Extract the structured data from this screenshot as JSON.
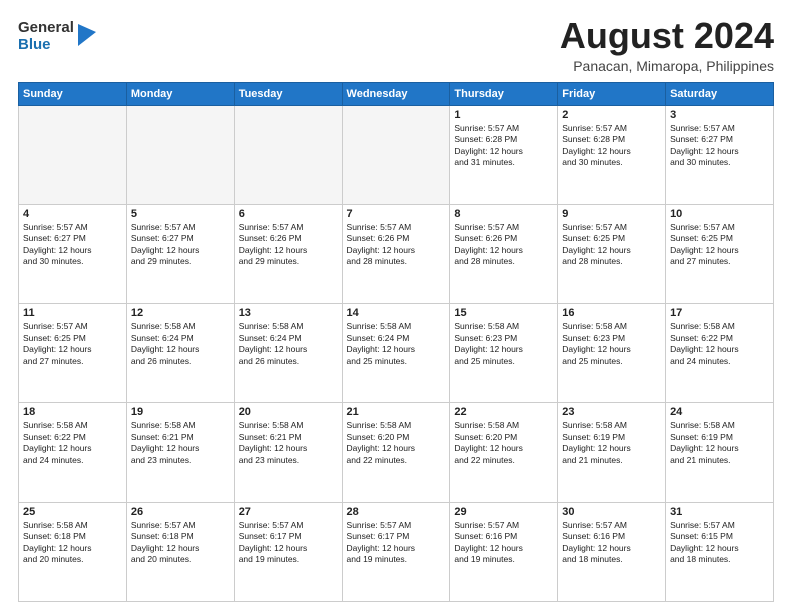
{
  "logo": {
    "general": "General",
    "blue": "Blue"
  },
  "title": "August 2024",
  "location": "Panacan, Mimaropa, Philippines",
  "weekdays": [
    "Sunday",
    "Monday",
    "Tuesday",
    "Wednesday",
    "Thursday",
    "Friday",
    "Saturday"
  ],
  "weeks": [
    [
      {
        "day": "",
        "info": ""
      },
      {
        "day": "",
        "info": ""
      },
      {
        "day": "",
        "info": ""
      },
      {
        "day": "",
        "info": ""
      },
      {
        "day": "1",
        "info": "Sunrise: 5:57 AM\nSunset: 6:28 PM\nDaylight: 12 hours\nand 31 minutes."
      },
      {
        "day": "2",
        "info": "Sunrise: 5:57 AM\nSunset: 6:28 PM\nDaylight: 12 hours\nand 30 minutes."
      },
      {
        "day": "3",
        "info": "Sunrise: 5:57 AM\nSunset: 6:27 PM\nDaylight: 12 hours\nand 30 minutes."
      }
    ],
    [
      {
        "day": "4",
        "info": "Sunrise: 5:57 AM\nSunset: 6:27 PM\nDaylight: 12 hours\nand 30 minutes."
      },
      {
        "day": "5",
        "info": "Sunrise: 5:57 AM\nSunset: 6:27 PM\nDaylight: 12 hours\nand 29 minutes."
      },
      {
        "day": "6",
        "info": "Sunrise: 5:57 AM\nSunset: 6:26 PM\nDaylight: 12 hours\nand 29 minutes."
      },
      {
        "day": "7",
        "info": "Sunrise: 5:57 AM\nSunset: 6:26 PM\nDaylight: 12 hours\nand 28 minutes."
      },
      {
        "day": "8",
        "info": "Sunrise: 5:57 AM\nSunset: 6:26 PM\nDaylight: 12 hours\nand 28 minutes."
      },
      {
        "day": "9",
        "info": "Sunrise: 5:57 AM\nSunset: 6:25 PM\nDaylight: 12 hours\nand 28 minutes."
      },
      {
        "day": "10",
        "info": "Sunrise: 5:57 AM\nSunset: 6:25 PM\nDaylight: 12 hours\nand 27 minutes."
      }
    ],
    [
      {
        "day": "11",
        "info": "Sunrise: 5:57 AM\nSunset: 6:25 PM\nDaylight: 12 hours\nand 27 minutes."
      },
      {
        "day": "12",
        "info": "Sunrise: 5:58 AM\nSunset: 6:24 PM\nDaylight: 12 hours\nand 26 minutes."
      },
      {
        "day": "13",
        "info": "Sunrise: 5:58 AM\nSunset: 6:24 PM\nDaylight: 12 hours\nand 26 minutes."
      },
      {
        "day": "14",
        "info": "Sunrise: 5:58 AM\nSunset: 6:24 PM\nDaylight: 12 hours\nand 25 minutes."
      },
      {
        "day": "15",
        "info": "Sunrise: 5:58 AM\nSunset: 6:23 PM\nDaylight: 12 hours\nand 25 minutes."
      },
      {
        "day": "16",
        "info": "Sunrise: 5:58 AM\nSunset: 6:23 PM\nDaylight: 12 hours\nand 25 minutes."
      },
      {
        "day": "17",
        "info": "Sunrise: 5:58 AM\nSunset: 6:22 PM\nDaylight: 12 hours\nand 24 minutes."
      }
    ],
    [
      {
        "day": "18",
        "info": "Sunrise: 5:58 AM\nSunset: 6:22 PM\nDaylight: 12 hours\nand 24 minutes."
      },
      {
        "day": "19",
        "info": "Sunrise: 5:58 AM\nSunset: 6:21 PM\nDaylight: 12 hours\nand 23 minutes."
      },
      {
        "day": "20",
        "info": "Sunrise: 5:58 AM\nSunset: 6:21 PM\nDaylight: 12 hours\nand 23 minutes."
      },
      {
        "day": "21",
        "info": "Sunrise: 5:58 AM\nSunset: 6:20 PM\nDaylight: 12 hours\nand 22 minutes."
      },
      {
        "day": "22",
        "info": "Sunrise: 5:58 AM\nSunset: 6:20 PM\nDaylight: 12 hours\nand 22 minutes."
      },
      {
        "day": "23",
        "info": "Sunrise: 5:58 AM\nSunset: 6:19 PM\nDaylight: 12 hours\nand 21 minutes."
      },
      {
        "day": "24",
        "info": "Sunrise: 5:58 AM\nSunset: 6:19 PM\nDaylight: 12 hours\nand 21 minutes."
      }
    ],
    [
      {
        "day": "25",
        "info": "Sunrise: 5:58 AM\nSunset: 6:18 PM\nDaylight: 12 hours\nand 20 minutes."
      },
      {
        "day": "26",
        "info": "Sunrise: 5:57 AM\nSunset: 6:18 PM\nDaylight: 12 hours\nand 20 minutes."
      },
      {
        "day": "27",
        "info": "Sunrise: 5:57 AM\nSunset: 6:17 PM\nDaylight: 12 hours\nand 19 minutes."
      },
      {
        "day": "28",
        "info": "Sunrise: 5:57 AM\nSunset: 6:17 PM\nDaylight: 12 hours\nand 19 minutes."
      },
      {
        "day": "29",
        "info": "Sunrise: 5:57 AM\nSunset: 6:16 PM\nDaylight: 12 hours\nand 19 minutes."
      },
      {
        "day": "30",
        "info": "Sunrise: 5:57 AM\nSunset: 6:16 PM\nDaylight: 12 hours\nand 18 minutes."
      },
      {
        "day": "31",
        "info": "Sunrise: 5:57 AM\nSunset: 6:15 PM\nDaylight: 12 hours\nand 18 minutes."
      }
    ]
  ]
}
